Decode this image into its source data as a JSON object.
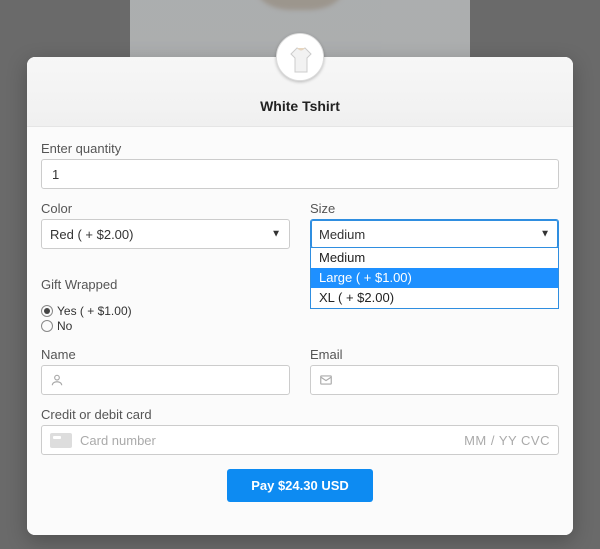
{
  "header": {
    "title": "White Tshirt"
  },
  "quantity": {
    "label": "Enter quantity",
    "value": "1"
  },
  "color": {
    "label": "Color",
    "selected": "Red ( + $2.00)"
  },
  "size": {
    "label": "Size",
    "selected": "Medium",
    "options": [
      {
        "label": "Medium",
        "highlight": false
      },
      {
        "label": "Large ( + $1.00)",
        "highlight": true
      },
      {
        "label": "XL ( + $2.00)",
        "highlight": false
      }
    ]
  },
  "gift": {
    "label": "Gift Wrapped",
    "yes": "Yes ( + $1.00)",
    "no": "No"
  },
  "name": {
    "label": "Name"
  },
  "email": {
    "label": "Email"
  },
  "card": {
    "label": "Credit or debit card",
    "placeholder": "Card number",
    "hint": "MM / YY  CVC"
  },
  "pay": {
    "label": "Pay $24.30 USD"
  }
}
